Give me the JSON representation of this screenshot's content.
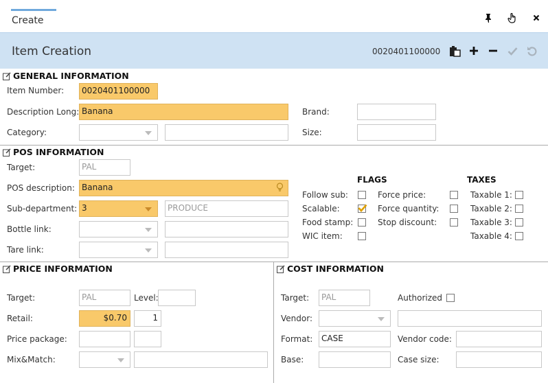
{
  "tab": {
    "title": "Create"
  },
  "header": {
    "title": "Item Creation",
    "item_number": "0020401100000"
  },
  "general": {
    "title": "GENERAL INFORMATION",
    "item_number_label": "Item Number:",
    "item_number_value": "0020401100000",
    "description_long_label": "Description Long:",
    "description_long_value": "Banana",
    "category_label": "Category:",
    "brand_label": "Brand:",
    "size_label": "Size:"
  },
  "pos": {
    "title": "POS INFORMATION",
    "target_label": "Target:",
    "target_value": "PAL",
    "pos_description_label": "POS description:",
    "pos_description_value": "Banana",
    "sub_department_label": "Sub-department:",
    "sub_department_value": "3",
    "sub_department_name": "PRODUCE",
    "bottle_link_label": "Bottle link:",
    "tare_link_label": "Tare link:",
    "flags_title": "FLAGS",
    "taxes_title": "TAXES",
    "flags": {
      "follow_sub": "Follow sub:",
      "scalable": "Scalable:",
      "food_stamp": "Food stamp:",
      "wic_item": "WIC item:",
      "force_price": "Force price:",
      "force_quantity": "Force quantity:",
      "stop_discount": "Stop discount:"
    },
    "taxes": {
      "taxable1": "Taxable 1:",
      "taxable2": "Taxable 2:",
      "taxable3": "Taxable 3:",
      "taxable4": "Taxable 4:"
    }
  },
  "price": {
    "title": "PRICE INFORMATION",
    "target_label": "Target:",
    "target_value": "PAL",
    "level_label": "Level:",
    "retail_label": "Retail:",
    "retail_value": "$0.70",
    "retail_qty": "1",
    "price_package_label": "Price package:",
    "mix_match_label": "Mix&Match:"
  },
  "cost": {
    "title": "COST INFORMATION",
    "target_label": "Target:",
    "target_value": "PAL",
    "authorized_label": "Authorized",
    "vendor_label": "Vendor:",
    "format_label": "Format:",
    "format_value": "CASE",
    "vendor_code_label": "Vendor code:",
    "base_label": "Base:",
    "case_size_label": "Case size:"
  },
  "colors": {
    "highlight": "#f9c96a",
    "header_bg": "#cfe2f3",
    "check": "#e0a000"
  }
}
